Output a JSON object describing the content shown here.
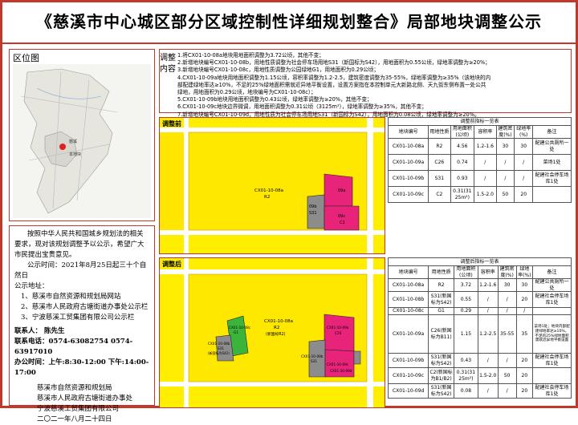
{
  "title": "《慈溪市中心城区部分区域控制性详细规划整合》局部地块调整公示",
  "location": {
    "label": "区位图",
    "site_label": "本地块",
    "map_label": "慈溪"
  },
  "content": {
    "tag": "调整内容",
    "items": [
      "1.将CX01-10-08a地块用地面积调整为3.72公顷，其他不变；",
      "2.新增地块编号CX01-10-08b，用地性质调整为社会停车场用地S31（新国标为S42），用地面积为0.55公顷，绿地率调整为≥20%；",
      "3.新增地块编号CX01-10-08c，用地性质调整为公园绿地G1，用地面积为0.29公顷；",
      "4.CX01-10-09a地块用地面积调整为1.15公顷，容积率调整为1.2-2.5，建筑密度调整为35-55%，绿地率调整为≥35%（该地块的内",
      "部配建绿地率达≥10%，不足的25%绿地面积需就近异地平衡设置，设置方案指在本控制单元大新路北侧、天九街东侧布置一处公共",
      "绿地，用地面积为0.29公顷，地块编号为CX01-10-08c）；",
      "5.CX01-10-09b地块用地面积调整为0.43公顷，绿地率调整为≥20%，其他不变；",
      "6.CX01-10-09c地块边界微调，用地面积调整为0.31公顷（3125m²），绿地率调整为≥35%，其他不变；",
      "7.新增地块编号CX01-10-09d，用地性质为社会停车场用地S31（新国标为S42），用地面积为0.08公顷，绿地率调整为≥20%。"
    ]
  },
  "map_before": {
    "label": "调整前",
    "parcel_main": "CX01-10-08a",
    "parcel_main_use": "R2",
    "parcel_09a": "09a",
    "parcel_09b": "09b",
    "parcel_09b_use": "S31",
    "parcel_09c": "09c",
    "parcel_09c_use": "C2"
  },
  "map_after": {
    "label": "调整后",
    "parcel_main": "CX01-10-08a",
    "parcel_main_use": "R2",
    "parcel_main_note": "(新国标R2)",
    "parcel_08b": "CX01-10-08b",
    "parcel_08b_use": "S31",
    "parcel_08b_note": "(新国标为S42)",
    "parcel_08c": "CX01-10-08c",
    "parcel_08c_use": "G1",
    "parcel_09a": "CX01-10-09a",
    "parcel_09a_use": "C26",
    "parcel_09b": "CX01-10-09b",
    "parcel_09b_use": "S31",
    "parcel_09c": "CX01-10-09c",
    "parcel_09d": "CX01-10-09d"
  },
  "table_before": {
    "title": "调整前指标一览表",
    "headers": [
      "地块编号",
      "用地性质",
      "用地面积(公顷)",
      "容积率",
      "建筑密度(%)",
      "绿地率(%)",
      "备注"
    ],
    "rows": [
      [
        "CX01-10-08a",
        "R2",
        "4.56",
        "1.2-1.6",
        "30",
        "30",
        "配建公共厕所一处"
      ],
      [
        "CX01-10-09a",
        "C26",
        "0.74",
        "/",
        "/",
        "/",
        "菜场1处"
      ],
      [
        "CX01-10-09b",
        "S31",
        "0.93",
        "/",
        "/",
        "/",
        "配建社会停车场库1处"
      ],
      [
        "CX01-10-09c",
        "C2",
        "0.31(3125m²)",
        "1.5-2.0",
        "50",
        "20",
        ""
      ]
    ]
  },
  "table_after": {
    "title": "调整后指标一览表",
    "headers": [
      "地块编号",
      "用地性质",
      "用地面积(公顷)",
      "容积率",
      "建筑密度(%)",
      "绿地率(%)",
      "备注"
    ],
    "rows": [
      [
        "CX01-10-08a",
        "R2",
        "3.72",
        "1.2-1.6",
        "30",
        "30",
        "配建公共厕所一处"
      ],
      [
        "CX01-10-08b",
        "S31(新国标为S42)",
        "0.55",
        "/",
        "/",
        "20",
        "配建社会停车场库1处"
      ],
      [
        "CX01-10-08c",
        "G1",
        "0.29",
        "/",
        "/",
        "/",
        ""
      ],
      [
        "CX01-10-09a",
        "C26(新国标为B11)",
        "1.15",
        "1.2-2.5",
        "35-55",
        "35",
        "菜场1处；地块内部配建绿地率达≥10%，不足的25%绿地面积需就近异地平衡设置"
      ],
      [
        "CX01-10-09b",
        "S31(新国标为S42)",
        "0.43",
        "/",
        "/",
        "20",
        "配建社会停车场库1处"
      ],
      [
        "CX01-10-09c",
        "C2(新国标为B1/B2)",
        "0.31(3125m²)",
        "1.5-2.0",
        "50",
        "20",
        ""
      ],
      [
        "CX01-10-09d",
        "S31(新国标为S42)",
        "0.08",
        "/",
        "/",
        "20",
        "配建社会停车场库1处"
      ]
    ]
  },
  "notice": {
    "intro": "按照中华人民共和国城乡规划法的相关要求，现对该规划调整予以公示，希望广大市民提出宝贵意见。",
    "period": "公示时间：2021年8月25日起三十个自然日",
    "places_title": "公示地址：",
    "places": [
      "1、慈溪市自然资源和规划局网站",
      "2、慈溪市人民政府古塘街道办事处公示栏",
      "3、宁波慈溪工贸集团有限公司公示栏"
    ],
    "contact_person": "联系人：  陈先生",
    "contact_phone": "联系电话：0574-63082754    0574-63917010",
    "office_hours": "办公时间：上午:8:30-12:00  下午:14:00-17:00",
    "signers": [
      "慈溪市自然资源和规划局",
      "慈溪市人民政府古塘街道办事处",
      "宁波慈溪工贸集团有限公司"
    ],
    "date": "二〇二一年八月二十四日"
  },
  "colors": {
    "border": "#c0392b",
    "residential": "#ffee00",
    "commercial": "#e8247a",
    "parking": "#8c8c8c",
    "green": "#3cb43c",
    "road": "#ffffff"
  }
}
